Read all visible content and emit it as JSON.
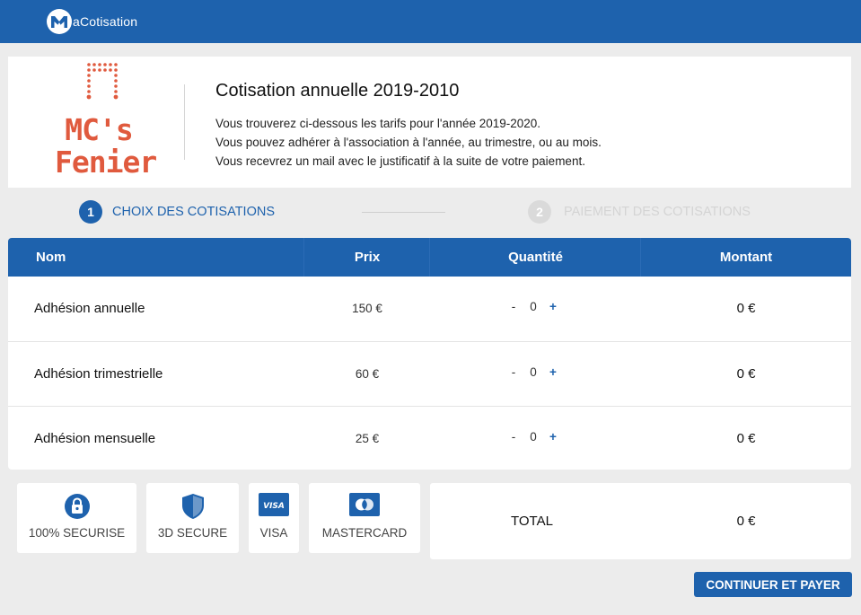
{
  "brand": {
    "name": "aCotisation",
    "logo_icon": "m-droplet-logo-icon"
  },
  "hero": {
    "logo_line1": "MC's",
    "logo_line2": "Fenier",
    "title": "Cotisation annuelle 2019-2010",
    "lines": [
      "Vous trouverez ci-dessous les tarifs pour l'année 2019-2020.",
      "Vous pouvez adhérer à l'association à l'année, au trimestre, ou au mois.",
      "Vous recevrez un mail avec le justificatif à la suite de votre paiement."
    ]
  },
  "steps": [
    {
      "num": "1",
      "label": "CHOIX DES COTISATIONS",
      "active": true
    },
    {
      "num": "2",
      "label": "PAIEMENT DES COTISATIONS",
      "active": false
    }
  ],
  "table": {
    "headers": {
      "name": "Nom",
      "price": "Prix",
      "qty": "Quantité",
      "amount": "Montant"
    },
    "rows": [
      {
        "name": "Adhésion annuelle",
        "price": "150 €",
        "minus": "-",
        "qty": "0",
        "plus": "+",
        "amount": "0 €"
      },
      {
        "name": "Adhésion trimestrielle",
        "price": "60 €",
        "minus": "-",
        "qty": "0",
        "plus": "+",
        "amount": "0 €"
      },
      {
        "name": "Adhésion mensuelle",
        "price": "25 €",
        "minus": "-",
        "qty": "0",
        "plus": "+",
        "amount": "0 €"
      }
    ]
  },
  "badges": [
    {
      "label": "100% SECURISE",
      "icon": "padlock-icon"
    },
    {
      "label": "3D SECURE",
      "icon": "shield-icon"
    },
    {
      "label": "VISA",
      "icon": "visa-card-icon",
      "icon_text": "VISA"
    },
    {
      "label": "MASTERCARD",
      "icon": "mastercard-card-icon"
    }
  ],
  "total": {
    "label": "TOTAL",
    "value": "0 €"
  },
  "cta": {
    "label": "CONTINUER ET PAYER"
  },
  "colors": {
    "primary": "#1e62ad",
    "logo": "#e05a3e",
    "inactive": "#dadada",
    "background": "#ececec"
  }
}
